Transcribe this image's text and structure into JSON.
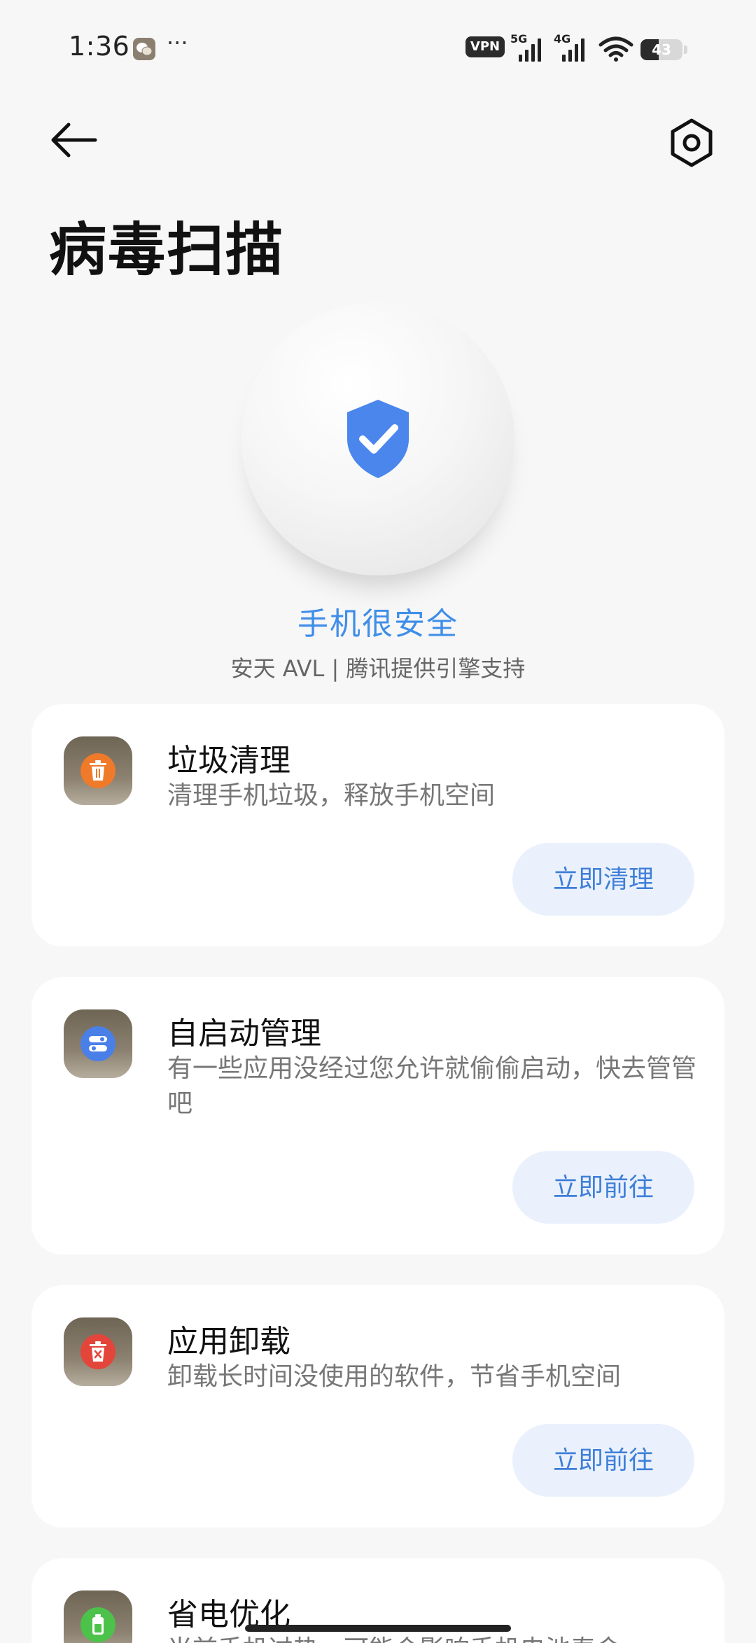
{
  "status_bar": {
    "time": "1:36",
    "dots": "···",
    "vpn": "VPN",
    "net1": "5G",
    "net2": "4G",
    "battery_level": "43",
    "battery_fraction": 0.43
  },
  "header": {
    "title": "病毒扫描"
  },
  "hero": {
    "status": "手机很安全",
    "engine": "安天 AVL | 腾讯提供引擎支持",
    "accent_color": "#4a86ec"
  },
  "cards": [
    {
      "title": "垃圾清理",
      "desc": "清理手机垃圾，释放手机空间",
      "button": "立即清理",
      "icon": "trash-icon",
      "icon_color": "#ee7a2a"
    },
    {
      "title": "自启动管理",
      "desc": "有一些应用没经过您允许就偷偷启动，快去管管吧",
      "button": "立即前往",
      "icon": "toggle-icon",
      "icon_color": "#4a7fe8"
    },
    {
      "title": "应用卸载",
      "desc": "卸载长时间没使用的软件，节省手机空间",
      "button": "立即前往",
      "icon": "uninstall-icon",
      "icon_color": "#e4453a"
    },
    {
      "title": "省电优化",
      "desc": "当前手机过热，可能会影响手机电池寿命",
      "icon": "battery-icon",
      "icon_color": "#4cc24a"
    }
  ]
}
